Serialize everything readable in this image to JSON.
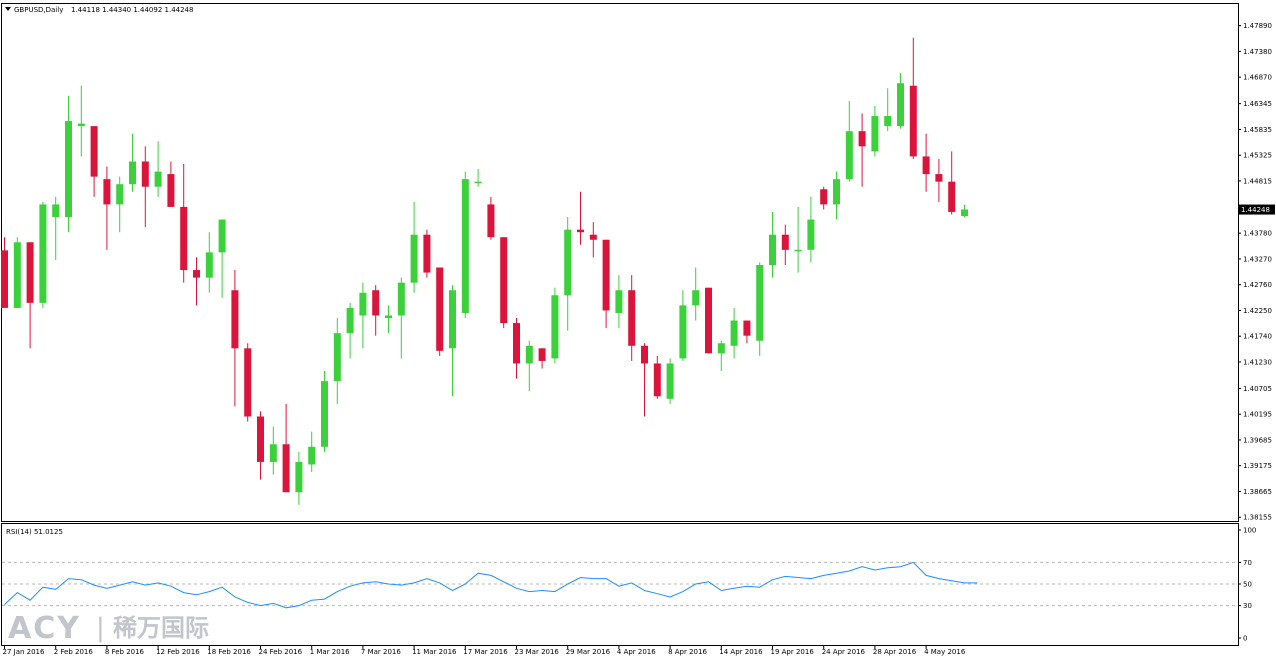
{
  "header": {
    "symbol_label": "GBPUSD,Daily",
    "ohlc_label": "1.44118 1.44340 1.44092 1.44248"
  },
  "watermark": {
    "brand": "ACY",
    "separator": "|",
    "chinese": "稀万国际"
  },
  "chart_data": [
    {
      "type": "candlestick",
      "title": "GBPUSD,Daily",
      "price_ticks": [
        "1.47890",
        "1.47380",
        "1.46870",
        "1.46345",
        "1.45835",
        "1.45325",
        "1.44815",
        "1.44248",
        "1.43780",
        "1.43270",
        "1.42760",
        "1.42250",
        "1.41740",
        "1.41230",
        "1.40705",
        "1.40195",
        "1.39685",
        "1.39175",
        "1.38665",
        "1.38155"
      ],
      "current_price_label": "1.44248",
      "x_labels": [
        "27 Jan 2016",
        "2 Feb 2016",
        "8 Feb 2016",
        "12 Feb 2016",
        "18 Feb 2016",
        "24 Feb 2016",
        "1 Mar 2016",
        "7 Mar 2016",
        "11 Mar 2016",
        "17 Mar 2016",
        "23 Mar 2016",
        "29 Mar 2016",
        "4 Apr 2016",
        "8 Apr 2016",
        "14 Apr 2016",
        "19 Apr 2016",
        "24 Apr 2016",
        "28 Apr 2016",
        "4 May 2016"
      ],
      "ylim": [
        1.381,
        1.4818
      ],
      "up_color": "#3ad13a",
      "down_color": "#dc143c",
      "candles": [
        {
          "o": 1.4344,
          "h": 1.437,
          "l": 1.423,
          "c": 1.423
        },
        {
          "o": 1.423,
          "h": 1.437,
          "l": 1.423,
          "c": 1.436
        },
        {
          "o": 1.436,
          "h": 1.436,
          "l": 1.415,
          "c": 1.424
        },
        {
          "o": 1.424,
          "h": 1.444,
          "l": 1.423,
          "c": 1.4435
        },
        {
          "o": 1.441,
          "h": 1.445,
          "l": 1.4325,
          "c": 1.4435
        },
        {
          "o": 1.441,
          "h": 1.465,
          "l": 1.438,
          "c": 1.46
        },
        {
          "o": 1.459,
          "h": 1.467,
          "l": 1.453,
          "c": 1.4595
        },
        {
          "o": 1.459,
          "h": 1.459,
          "l": 1.445,
          "c": 1.449
        },
        {
          "o": 1.4485,
          "h": 1.451,
          "l": 1.4345,
          "c": 1.4435
        },
        {
          "o": 1.4435,
          "h": 1.449,
          "l": 1.438,
          "c": 1.4475
        },
        {
          "o": 1.4475,
          "h": 1.4575,
          "l": 1.446,
          "c": 1.452
        },
        {
          "o": 1.452,
          "h": 1.455,
          "l": 1.439,
          "c": 1.447
        },
        {
          "o": 1.447,
          "h": 1.456,
          "l": 1.445,
          "c": 1.45
        },
        {
          "o": 1.4495,
          "h": 1.452,
          "l": 1.443,
          "c": 1.443
        },
        {
          "o": 1.443,
          "h": 1.4515,
          "l": 1.428,
          "c": 1.4305
        },
        {
          "o": 1.4305,
          "h": 1.433,
          "l": 1.4235,
          "c": 1.429
        },
        {
          "o": 1.429,
          "h": 1.438,
          "l": 1.426,
          "c": 1.434
        },
        {
          "o": 1.434,
          "h": 1.4405,
          "l": 1.425,
          "c": 1.4405
        },
        {
          "o": 1.4265,
          "h": 1.4305,
          "l": 1.4035,
          "c": 1.415
        },
        {
          "o": 1.415,
          "h": 1.416,
          "l": 1.4005,
          "c": 1.4015
        },
        {
          "o": 1.4015,
          "h": 1.4025,
          "l": 1.389,
          "c": 1.3925
        },
        {
          "o": 1.3925,
          "h": 1.3995,
          "l": 1.39,
          "c": 1.396
        },
        {
          "o": 1.396,
          "h": 1.404,
          "l": 1.3865,
          "c": 1.3865
        },
        {
          "o": 1.3865,
          "h": 1.3945,
          "l": 1.384,
          "c": 1.3925
        },
        {
          "o": 1.392,
          "h": 1.3985,
          "l": 1.3905,
          "c": 1.3955
        },
        {
          "o": 1.3955,
          "h": 1.4105,
          "l": 1.3945,
          "c": 1.4085
        },
        {
          "o": 1.4085,
          "h": 1.421,
          "l": 1.404,
          "c": 1.418
        },
        {
          "o": 1.418,
          "h": 1.424,
          "l": 1.413,
          "c": 1.423
        },
        {
          "o": 1.4215,
          "h": 1.428,
          "l": 1.415,
          "c": 1.426
        },
        {
          "o": 1.4265,
          "h": 1.4275,
          "l": 1.4175,
          "c": 1.4215
        },
        {
          "o": 1.421,
          "h": 1.4235,
          "l": 1.418,
          "c": 1.4215
        },
        {
          "o": 1.4215,
          "h": 1.429,
          "l": 1.413,
          "c": 1.428
        },
        {
          "o": 1.428,
          "h": 1.444,
          "l": 1.426,
          "c": 1.4375
        },
        {
          "o": 1.4375,
          "h": 1.4385,
          "l": 1.429,
          "c": 1.43
        },
        {
          "o": 1.431,
          "h": 1.431,
          "l": 1.4135,
          "c": 1.4145
        },
        {
          "o": 1.415,
          "h": 1.4275,
          "l": 1.4055,
          "c": 1.4265
        },
        {
          "o": 1.422,
          "h": 1.45,
          "l": 1.421,
          "c": 1.4485
        },
        {
          "o": 1.448,
          "h": 1.4505,
          "l": 1.447,
          "c": 1.448
        },
        {
          "o": 1.4435,
          "h": 1.445,
          "l": 1.4365,
          "c": 1.437
        },
        {
          "o": 1.437,
          "h": 1.437,
          "l": 1.419,
          "c": 1.42
        },
        {
          "o": 1.42,
          "h": 1.421,
          "l": 1.409,
          "c": 1.412
        },
        {
          "o": 1.412,
          "h": 1.4165,
          "l": 1.4065,
          "c": 1.4155
        },
        {
          "o": 1.415,
          "h": 1.415,
          "l": 1.411,
          "c": 1.4125
        },
        {
          "o": 1.413,
          "h": 1.427,
          "l": 1.412,
          "c": 1.4255
        },
        {
          "o": 1.4255,
          "h": 1.441,
          "l": 1.4185,
          "c": 1.4385
        },
        {
          "o": 1.4385,
          "h": 1.446,
          "l": 1.4355,
          "c": 1.438
        },
        {
          "o": 1.4375,
          "h": 1.44,
          "l": 1.433,
          "c": 1.4365
        },
        {
          "o": 1.4365,
          "h": 1.4365,
          "l": 1.419,
          "c": 1.4225
        },
        {
          "o": 1.422,
          "h": 1.4295,
          "l": 1.419,
          "c": 1.4265
        },
        {
          "o": 1.4265,
          "h": 1.4295,
          "l": 1.4125,
          "c": 1.4155
        },
        {
          "o": 1.4155,
          "h": 1.416,
          "l": 1.4015,
          "c": 1.412
        },
        {
          "o": 1.412,
          "h": 1.4135,
          "l": 1.405,
          "c": 1.4055
        },
        {
          "o": 1.405,
          "h": 1.413,
          "l": 1.404,
          "c": 1.412
        },
        {
          "o": 1.413,
          "h": 1.4265,
          "l": 1.4125,
          "c": 1.4235
        },
        {
          "o": 1.4235,
          "h": 1.431,
          "l": 1.4205,
          "c": 1.4265
        },
        {
          "o": 1.427,
          "h": 1.427,
          "l": 1.414,
          "c": 1.414
        },
        {
          "o": 1.414,
          "h": 1.4165,
          "l": 1.4105,
          "c": 1.416
        },
        {
          "o": 1.4155,
          "h": 1.423,
          "l": 1.413,
          "c": 1.4205
        },
        {
          "o": 1.4205,
          "h": 1.4205,
          "l": 1.416,
          "c": 1.4175
        },
        {
          "o": 1.4165,
          "h": 1.432,
          "l": 1.4135,
          "c": 1.4315
        },
        {
          "o": 1.4315,
          "h": 1.442,
          "l": 1.429,
          "c": 1.4375
        },
        {
          "o": 1.4375,
          "h": 1.4395,
          "l": 1.4315,
          "c": 1.4345
        },
        {
          "o": 1.4345,
          "h": 1.443,
          "l": 1.43,
          "c": 1.4345
        },
        {
          "o": 1.4345,
          "h": 1.445,
          "l": 1.432,
          "c": 1.4405
        },
        {
          "o": 1.4465,
          "h": 1.447,
          "l": 1.4425,
          "c": 1.4435
        },
        {
          "o": 1.4435,
          "h": 1.45,
          "l": 1.4405,
          "c": 1.4485
        },
        {
          "o": 1.4485,
          "h": 1.464,
          "l": 1.448,
          "c": 1.458
        },
        {
          "o": 1.458,
          "h": 1.4615,
          "l": 1.447,
          "c": 1.455
        },
        {
          "o": 1.454,
          "h": 1.463,
          "l": 1.453,
          "c": 1.461
        },
        {
          "o": 1.459,
          "h": 1.4665,
          "l": 1.458,
          "c": 1.461
        },
        {
          "o": 1.459,
          "h": 1.4695,
          "l": 1.4585,
          "c": 1.4675
        },
        {
          "o": 1.467,
          "h": 1.4765,
          "l": 1.4525,
          "c": 1.453
        },
        {
          "o": 1.453,
          "h": 1.4575,
          "l": 1.446,
          "c": 1.4495
        },
        {
          "o": 1.4495,
          "h": 1.4525,
          "l": 1.444,
          "c": 1.448
        },
        {
          "o": 1.448,
          "h": 1.454,
          "l": 1.4415,
          "c": 1.442
        },
        {
          "o": 1.4412,
          "h": 1.4434,
          "l": 1.4409,
          "c": 1.4425
        }
      ]
    },
    {
      "type": "line",
      "title": "RSI(14) 51.0125",
      "ylim": [
        0,
        100
      ],
      "y_ticks": [
        "100",
        "70",
        "50",
        "30",
        "0"
      ],
      "levels": [
        70,
        50,
        30
      ],
      "line_color": "#1e90ff",
      "series": [
        {
          "values": [
            31,
            42,
            35,
            47,
            45,
            55,
            54,
            49,
            46,
            49,
            52,
            49,
            51,
            48,
            42,
            40,
            43,
            47,
            38,
            33,
            30,
            32,
            28,
            30,
            35,
            36,
            43,
            48,
            51,
            52,
            50,
            49,
            51,
            55,
            51,
            44,
            50,
            60,
            58,
            52,
            46,
            43,
            44,
            43,
            50,
            56,
            55,
            55,
            48,
            51,
            44,
            41,
            38,
            43,
            50,
            52,
            44,
            46,
            48,
            47,
            54,
            57,
            56,
            55,
            58,
            60,
            62,
            66,
            63,
            65,
            66,
            70,
            58,
            55,
            53,
            51,
            51
          ]
        }
      ]
    }
  ]
}
